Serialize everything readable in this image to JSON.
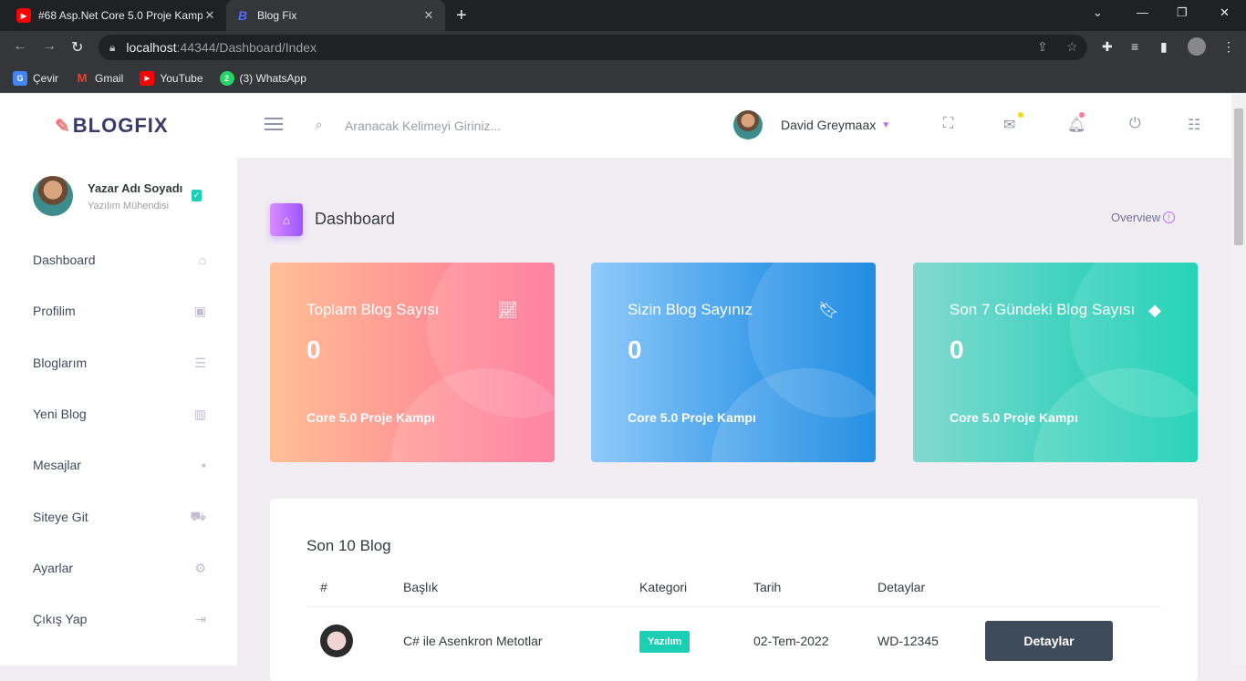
{
  "browser": {
    "tabs": [
      {
        "title": "#68 Asp.Net Core 5.0 Proje Kamp",
        "icon": "youtube-icon",
        "active": false
      },
      {
        "title": "Blog Fix",
        "icon": "blog-b-icon",
        "active": true
      }
    ],
    "url_host": "localhost",
    "url_path": ":44344/Dashboard/Index",
    "bookmarks": [
      {
        "label": "Çevir",
        "icon": "translate-icon",
        "color": "#4285f4"
      },
      {
        "label": "Gmail",
        "icon": "gmail-icon",
        "color": "#ea4335"
      },
      {
        "label": "YouTube",
        "icon": "youtube-icon",
        "color": "#ff0000"
      },
      {
        "label": "(3) WhatsApp",
        "icon": "whatsapp-icon",
        "color": "#25d366"
      }
    ]
  },
  "brand": {
    "logo": "BLOGFIX"
  },
  "profile": {
    "name": "Yazar Adı Soyadı",
    "role": "Yazılım Mühendisi"
  },
  "sidebar": {
    "items": [
      {
        "label": "Dashboard",
        "icon": "home-icon"
      },
      {
        "label": "Profilim",
        "icon": "contact-card-icon"
      },
      {
        "label": "Bloglarım",
        "icon": "list-icon"
      },
      {
        "label": "Yeni Blog",
        "icon": "bar-chart-icon"
      },
      {
        "label": "Mesajlar",
        "icon": "message-icon"
      },
      {
        "label": "Siteye Git",
        "icon": "car-icon"
      },
      {
        "label": "Ayarlar",
        "icon": "gear-icon"
      },
      {
        "label": "Çıkış Yap",
        "icon": "logout-icon"
      }
    ]
  },
  "topbar": {
    "search_placeholder": "Aranacak Kelimeyi Giriniz...",
    "username": "David Greymaax"
  },
  "page": {
    "title": "Dashboard",
    "overview": "Overview"
  },
  "cards": [
    {
      "title": "Toplam Blog Sayısı",
      "value": "0",
      "footer": "Core 5.0 Proje Kampı",
      "icon": "line-chart-icon"
    },
    {
      "title": "Sizin Blog Sayınız",
      "value": "0",
      "footer": "Core 5.0 Proje Kampı",
      "icon": "bookmark-icon"
    },
    {
      "title": "Son 7 Gündeki Blog Sayısı",
      "value": "0",
      "footer": "Core 5.0 Proje Kampı",
      "icon": "diamond-icon"
    }
  ],
  "table": {
    "title": "Son 10 Blog",
    "headers": [
      "#",
      "Başlık",
      "Kategori",
      "Tarih",
      "Detaylar"
    ],
    "rows": [
      {
        "title": "C# ile Asenkron Metotlar",
        "category": "Yazılım",
        "date": "02-Tem-2022",
        "code": "WD-12345",
        "button": "Detaylar"
      }
    ]
  },
  "colors": {
    "accent": "#b66dff",
    "success": "#1bcfb4",
    "dark": "#3e4b5b"
  }
}
